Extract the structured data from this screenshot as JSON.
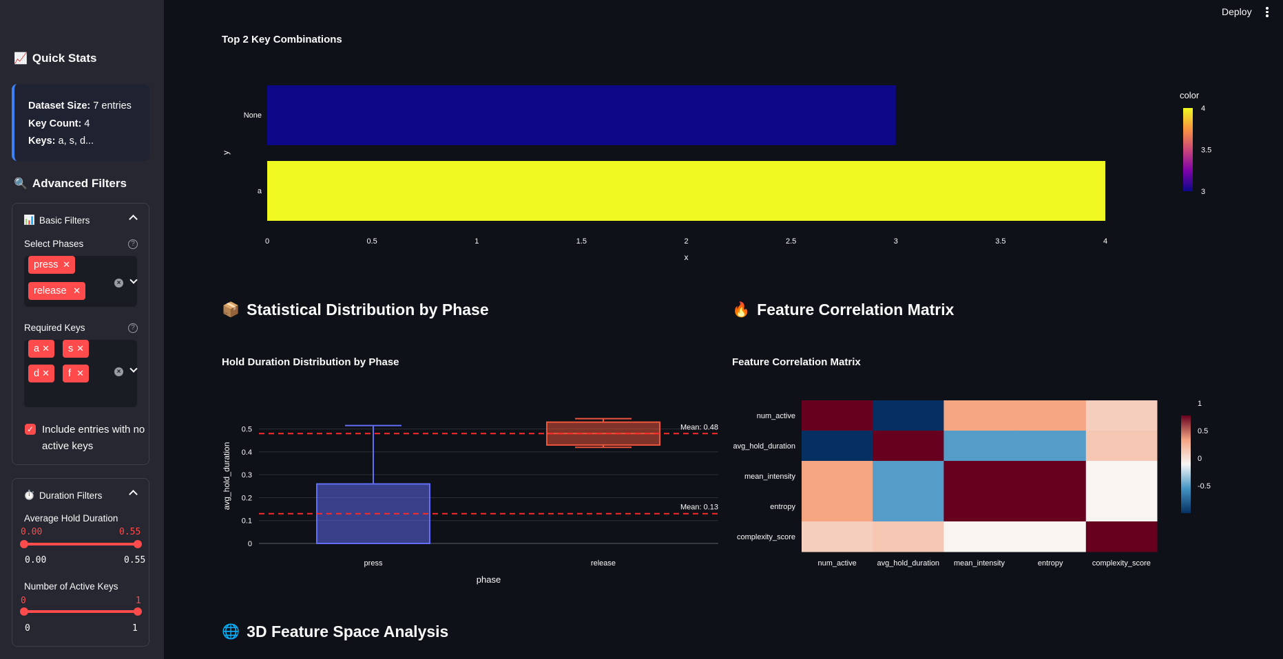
{
  "header": {
    "deploy_label": "Deploy",
    "menu_icon": "kebab-menu-icon"
  },
  "sidebar": {
    "quick_stats": {
      "emoji": "📈",
      "title": "Quick Stats"
    },
    "stats": [
      {
        "label": "Dataset Size:",
        "value": " 7 entries"
      },
      {
        "label": "Key Count:",
        "value": " 4"
      },
      {
        "label": "Keys:",
        "value": " a, s, d..."
      }
    ],
    "advanced_filters": {
      "emoji": "🔍",
      "title": "Advanced Filters"
    },
    "basic_filters": {
      "emoji": "📊",
      "title": "Basic Filters",
      "phases_label": "Select Phases",
      "phases": [
        "press",
        "release"
      ],
      "keys_label": "Required Keys",
      "keys": [
        "a",
        "s",
        "d",
        "f"
      ],
      "include_empty_label": "Include entries with no active keys",
      "include_empty_checked": true
    },
    "duration_filters": {
      "emoji": "⏱️",
      "title": "Duration Filters",
      "hold_label": "Average Hold Duration",
      "hold_value_low": "0.00",
      "hold_value_high": "0.55",
      "hold_min": "0.00",
      "hold_max": "0.55",
      "active_label": "Number of Active Keys",
      "active_value_low": "0",
      "active_value_high": "1",
      "active_min": "0",
      "active_max": "1"
    }
  },
  "main": {
    "top_chart_title": "Top 2 Key Combinations",
    "section_stats": {
      "emoji": "📦",
      "title": "Statistical Distribution by Phase"
    },
    "section_corr": {
      "emoji": "🔥",
      "title": "Feature Correlation Matrix"
    },
    "box_chart_title": "Hold Duration Distribution by Phase",
    "heatmap_title": "Feature Correlation Matrix",
    "section_3d": {
      "emoji": "🌐",
      "title": "3D Feature Space Analysis"
    }
  },
  "chart_data": [
    {
      "type": "bar",
      "orientation": "horizontal",
      "title": "Top 2 Key Combinations",
      "categories": [
        "None",
        "a"
      ],
      "values": [
        3,
        4
      ],
      "xlabel": "x",
      "ylabel": "y",
      "xticks": [
        "0",
        "0.5",
        "1",
        "1.5",
        "2",
        "2.5",
        "3",
        "3.5",
        "4"
      ],
      "xlim": [
        0,
        4
      ],
      "colorbar": {
        "title": "color",
        "ticks": [
          "4",
          "3.5",
          "3"
        ],
        "range": [
          3,
          4
        ],
        "scale": "plasma"
      },
      "bar_colors": [
        "#0d0887",
        "#f0f921"
      ]
    },
    {
      "type": "box",
      "title": "Hold Duration Distribution by Phase",
      "xlabel": "phase",
      "ylabel": "avg_hold_duration",
      "categories": [
        "press",
        "release"
      ],
      "yticks": [
        "0",
        "0.1",
        "0.2",
        "0.3",
        "0.4",
        "0.5"
      ],
      "ylim": [
        0,
        0.55
      ],
      "series": [
        {
          "name": "press",
          "min": 0,
          "q1": 0,
          "median": 0,
          "q3": 0.26,
          "max": 0.515,
          "color": "#636efa"
        },
        {
          "name": "release",
          "min": 0.42,
          "q1": 0.43,
          "median": 0.48,
          "q3": 0.53,
          "max": 0.545,
          "color": "#ef553b"
        }
      ],
      "mean_lines": [
        {
          "label": "Mean: 0.48",
          "value": 0.48
        },
        {
          "label": "Mean: 0.13",
          "value": 0.13
        }
      ]
    },
    {
      "type": "heatmap",
      "title": "Feature Correlation Matrix",
      "labels": [
        "num_active",
        "avg_hold_duration",
        "mean_intensity",
        "entropy",
        "complexity_score"
      ],
      "matrix": [
        [
          1,
          -1,
          0.5,
          0.5,
          0.25
        ],
        [
          -1,
          1,
          -0.45,
          -0.45,
          0.3
        ],
        [
          0.5,
          -0.45,
          1,
          1,
          0.02
        ],
        [
          0.5,
          -0.45,
          1,
          1,
          0.02
        ],
        [
          0.25,
          0.3,
          0.02,
          0.02,
          1
        ]
      ],
      "colorbar": {
        "ticks": [
          "1",
          "0.5",
          "0",
          "-0.5"
        ],
        "range": [
          -1,
          1
        ],
        "scale": "RdBu"
      }
    }
  ]
}
